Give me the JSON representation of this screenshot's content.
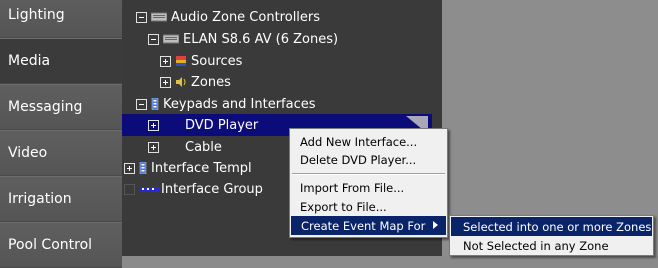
{
  "sidebar": {
    "items": [
      {
        "label": "Lighting"
      },
      {
        "label": "Media"
      },
      {
        "label": "Messaging"
      },
      {
        "label": "Video"
      },
      {
        "label": "Irrigation"
      },
      {
        "label": "Pool Control"
      }
    ],
    "active": "Media"
  },
  "tree": {
    "nodes": [
      {
        "label": "Audio Zone Controllers",
        "icon": "controller-icon",
        "expander": "minus"
      },
      {
        "label": "ELAN S8.6 AV (6 Zones)",
        "icon": "device-icon",
        "expander": "minus"
      },
      {
        "label": "Sources",
        "icon": "sources-icon",
        "expander": "plus"
      },
      {
        "label": "Zones",
        "icon": "speaker-icon",
        "expander": "plus"
      },
      {
        "label": "Keypads and Interfaces",
        "icon": "keypad-icon",
        "expander": "minus"
      },
      {
        "label": "DVD Player",
        "expander": "plus",
        "selected": true
      },
      {
        "label": "Cable",
        "expander": "plus"
      },
      {
        "label": "Interface Templ",
        "icon": "keypad-icon",
        "expander": "plus"
      },
      {
        "label": "Interface Group",
        "icon": "group-icon",
        "expander": "none"
      }
    ]
  },
  "context_menu": {
    "items": [
      {
        "label": "Add New Interface..."
      },
      {
        "label": "Delete DVD Player..."
      },
      {
        "label": "Import From File..."
      },
      {
        "label": "Export to File..."
      },
      {
        "label": "Create Event Map For",
        "highlighted": true,
        "submenu": true
      }
    ]
  },
  "submenu": {
    "items": [
      {
        "label": "Selected into one or more Zones",
        "highlighted": true
      },
      {
        "label": "Not Selected in any Zone"
      }
    ]
  },
  "colors": {
    "selection": "#0b0b7a",
    "menu_highlight": "#0a246a",
    "sidebar_bg": "#5c5c5c",
    "tree_bg": "#3a3a3a"
  }
}
